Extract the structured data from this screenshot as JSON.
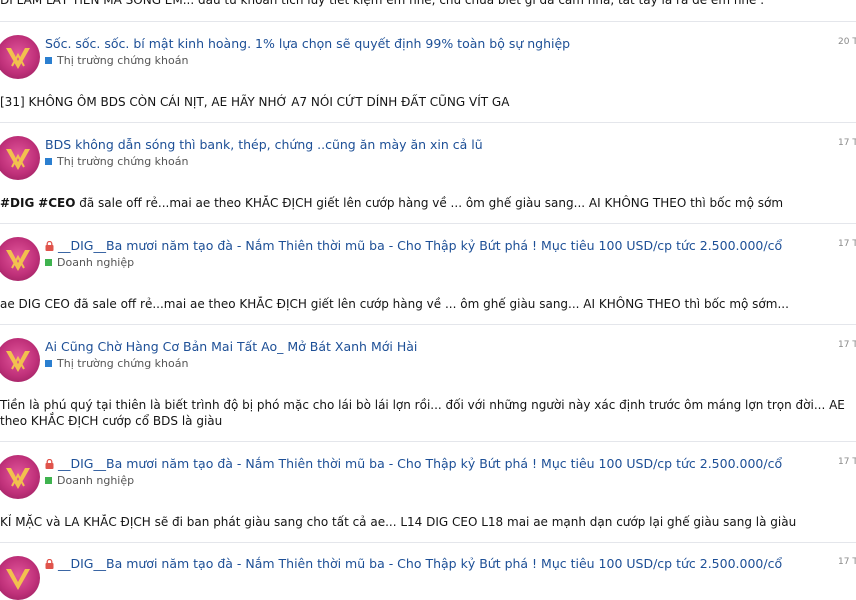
{
  "feed": {
    "top_excerpt": "ĐI LÀM LẤY TIỀN MÀ SỐNG EM... đầu tư khoản tích lũy tiết kiệm em nhé, chứ chưa biết gì đã cầm nhà, tất tay là ra đê em nhé .",
    "posts": [
      {
        "title": "Sốc. sốc. sốc. bí mật kinh hoàng. 1% lựa chọn sẽ quyết định 99% toàn bộ sự nghiệp",
        "forum": "Thị trường chứng khoán",
        "forum_color": "#2b7fd0",
        "date": "20 T",
        "locked": false,
        "excerpt": "[31] KHÔNG ÔM BDS CÒN CÁI NỊT, AE HÃY NHỚ A7 NÓI CỨT DÍNH ĐẤT CŨNG VÍT GA"
      },
      {
        "title": "BDS không dẫn sóng thì bank, thép, chứng ..cũng ăn mày ăn xin cả lũ",
        "forum": "Thị trường chứng khoán",
        "forum_color": "#2b7fd0",
        "date": "17 T",
        "locked": false,
        "excerpt_parts": [
          "",
          "#DIG",
          " ",
          "#CEO",
          " đã sale off rẻ...mai ae theo KHẮC ĐỊCH giết lên cướp hàng về ... ôm ghế giàu sang... AI KHÔNG THEO thì bốc mộ sớm"
        ]
      },
      {
        "title": "__DIG__Ba mươi năm tạo đà - Nắm Thiên thời mũ ba - Cho Thập kỷ Bứt phá ! Mục tiêu 100 USD/cp tức 2.500.000/cổ",
        "forum": "Doanh nghiệp",
        "forum_color": "#3fb34f",
        "date": "17 T",
        "locked": true,
        "excerpt": "ae DIG CEO đã sale off rẻ...mai ae theo KHẮC ĐỊCH giết lên cướp hàng về ... ôm ghế giàu sang... AI KHÔNG THEO thì bốc mộ sớm..."
      },
      {
        "title": "Ai Cũng Chờ Hàng Cơ Bản Mai Tất Ao_ Mở Bát Xanh Mới Hài",
        "forum": "Thị trường chứng khoán",
        "forum_color": "#2b7fd0",
        "date": "17 T",
        "locked": false,
        "excerpt": "Tiền là phú quý tại thiên là biết trình độ bị phó mặc cho lái bò lái lợn rồi... đối với những người này xác định trước ôm máng lợn trọn đời... AE theo KHẮC ĐỊCH cướp cổ BDS là giàu"
      },
      {
        "title": "__DIG__Ba mươi năm tạo đà - Nắm Thiên thời mũ ba - Cho Thập kỷ Bứt phá ! Mục tiêu 100 USD/cp tức 2.500.000/cổ",
        "forum": "Doanh nghiệp",
        "forum_color": "#3fb34f",
        "date": "17 T",
        "locked": true,
        "excerpt": "KỈ MẶC và LA KHẮC ĐỊCH sẽ đi ban phát giàu sang cho tất cả ae... L14 DIG CEO L18 mai ae mạnh dạn cướp lại ghế giàu sang là giàu"
      },
      {
        "title": "__DIG__Ba mươi năm tạo đà - Nắm Thiên thời mũ ba - Cho Thập kỷ Bứt phá ! Mục tiêu 100 USD/cp tức 2.500.000/cổ",
        "date": "17 T",
        "locked": true
      }
    ]
  }
}
